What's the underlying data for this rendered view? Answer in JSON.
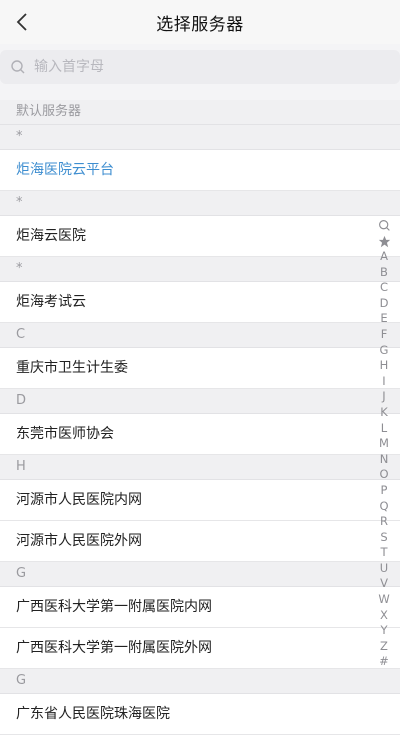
{
  "header": {
    "title": "选择服务器"
  },
  "search": {
    "placeholder": "输入首字母",
    "value": ""
  },
  "list": {
    "default_section_label": "默认服务器",
    "groups": [
      {
        "letter": "*",
        "items": [
          {
            "name": "炬海医院云平台",
            "selected": true
          }
        ]
      },
      {
        "letter": "*",
        "items": [
          {
            "name": "炬海云医院"
          }
        ]
      },
      {
        "letter": "*",
        "items": [
          {
            "name": "炬海考试云"
          }
        ]
      },
      {
        "letter": "C",
        "items": [
          {
            "name": "重庆市卫生计生委"
          }
        ]
      },
      {
        "letter": "D",
        "items": [
          {
            "name": "东莞市医师协会"
          }
        ]
      },
      {
        "letter": "H",
        "items": [
          {
            "name": "河源市人民医院内网"
          },
          {
            "name": "河源市人民医院外网"
          }
        ]
      },
      {
        "letter": "G",
        "items": [
          {
            "name": "广西医科大学第一附属医院内网"
          },
          {
            "name": "广西医科大学第一附属医院外网"
          }
        ]
      },
      {
        "letter": "G",
        "items": [
          {
            "name": "广东省人民医院珠海医院"
          }
        ]
      }
    ]
  },
  "index_bar": {
    "icons": [
      "search-icon",
      "star-icon"
    ],
    "letters": [
      "A",
      "B",
      "C",
      "D",
      "E",
      "F",
      "G",
      "H",
      "I",
      "J",
      "K",
      "L",
      "M",
      "N",
      "O",
      "P",
      "Q",
      "R",
      "S",
      "T",
      "U",
      "V",
      "W",
      "X",
      "Y",
      "Z",
      "#"
    ]
  },
  "colors": {
    "accent": "#3e8ed0",
    "section_text": "#9a9a9f"
  }
}
